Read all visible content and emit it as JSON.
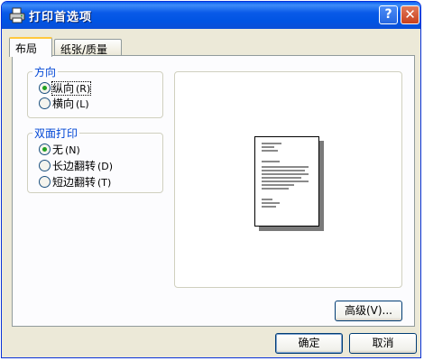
{
  "window": {
    "title": "打印首选项"
  },
  "tabs": [
    {
      "label": "布局",
      "active": true
    },
    {
      "label": "纸张/质量",
      "active": false
    }
  ],
  "orientation": {
    "title": "方向",
    "options": [
      {
        "label": "纵向",
        "key": "(R)",
        "checked": true
      },
      {
        "label": "横向",
        "key": "(L)",
        "checked": false
      }
    ]
  },
  "duplex": {
    "title": "双面打印",
    "options": [
      {
        "label": "无",
        "key": "(N)",
        "checked": true
      },
      {
        "label": "长边翻转",
        "key": "(D)",
        "checked": false
      },
      {
        "label": "短边翻转",
        "key": "(T)",
        "checked": false
      }
    ]
  },
  "buttons": {
    "advanced": "高级(V)...",
    "ok": "确定",
    "cancel": "取消"
  },
  "icons": {
    "title_icon": "printer-icon",
    "help": "help-icon",
    "close": "close-icon",
    "preview": "page-preview-icon"
  },
  "colors": {
    "titlebar": "#0054e3",
    "dialog_bg": "#ece9d8",
    "group_title": "#0046d5",
    "radio_dot": "#21a121",
    "close_button": "#c8401d"
  }
}
